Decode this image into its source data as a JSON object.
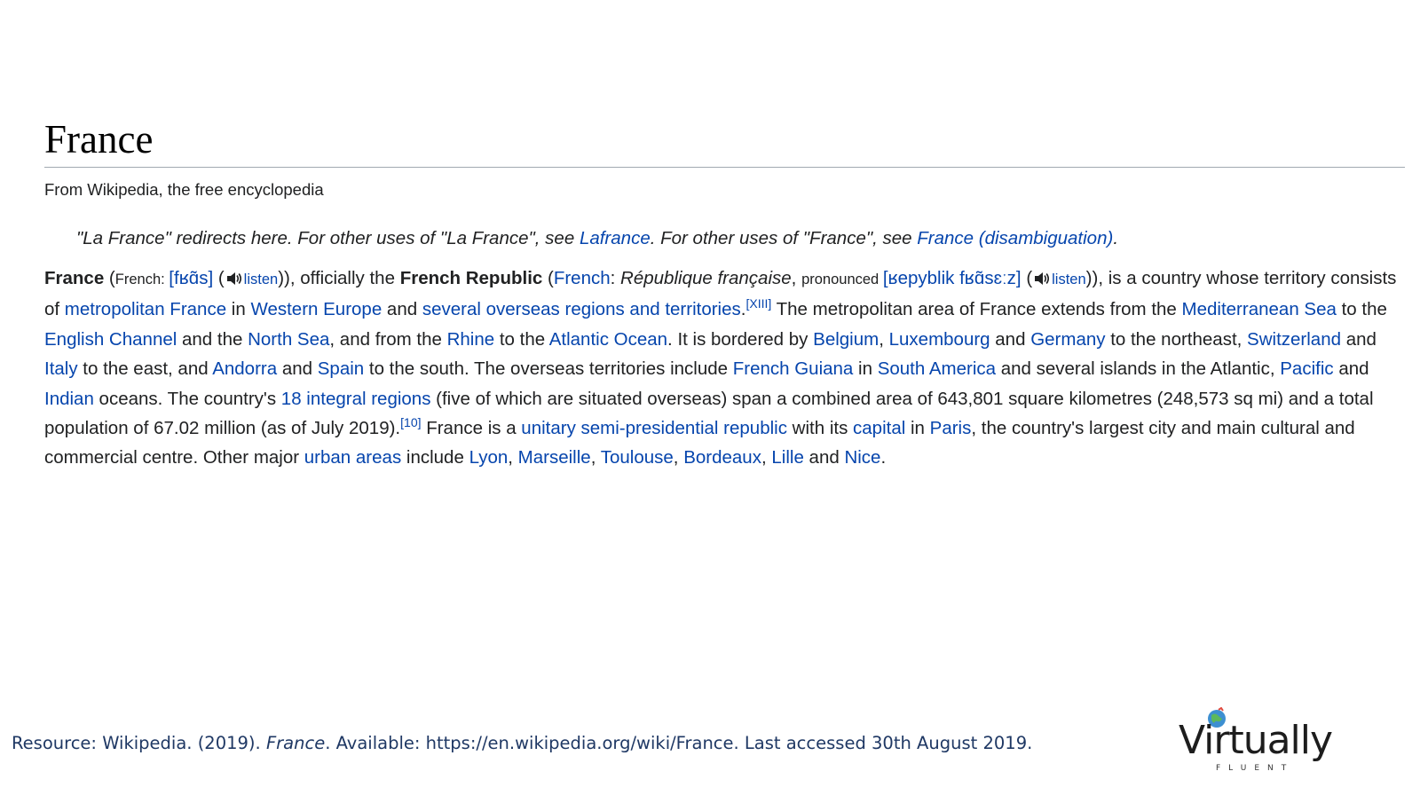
{
  "article": {
    "title": "France",
    "tagline": "From Wikipedia, the free encyclopedia",
    "hatnote": {
      "p1": "\"La France\" redirects here. For other uses of \"La France\", see ",
      "link1": "Lafrance",
      "p2": ". For other uses of \"France\", see ",
      "link2": "France (disambiguation)",
      "p3": "."
    },
    "lead": {
      "t1": "France",
      "t2": " (",
      "t3": "French: ",
      "l1": "[fʁɑ̃s]",
      "t4": " ",
      "l2": "listen",
      "t5": ")), officially the ",
      "t6": "French Republic",
      "t7": " (",
      "l3": "French",
      "t8": ": ",
      "t9": "République française",
      "t10": ", ",
      "t11": "pronounced ",
      "l4": "[ʁepyblik fʁɑ̃sɛːz]",
      "t12": " ",
      "l5": "listen",
      "t13": ")), is a country whose territory consists of ",
      "l6": "metropolitan France",
      "t14": " in ",
      "l7": "Western Europe",
      "t15": " and ",
      "l8": "several overseas regions and territories",
      "t16": ".",
      "s1": "[XIII]",
      "t17": " The metropolitan area of France extends from the ",
      "l9": "Mediterranean Sea",
      "t18": " to the ",
      "l10": "English Channel",
      "t19": " and the ",
      "l11": "North Sea",
      "t20": ", and from the ",
      "l12": "Rhine",
      "t21": " to the ",
      "l13": "Atlantic Ocean",
      "t22": ". It is bordered by ",
      "l14": "Belgium",
      "t23": ", ",
      "l15": "Luxembourg",
      "t24": " and ",
      "l16": "Germany",
      "t25": " to the northeast, ",
      "l17": "Switzerland",
      "t26": " and ",
      "l18": "Italy",
      "t27": " to the east, and ",
      "l19": "Andorra",
      "t28": " and ",
      "l20": "Spain",
      "t29": " to the south. The overseas territories include ",
      "l21": "French Guiana",
      "t30": " in ",
      "l22": "South America",
      "t31": " and several islands in the Atlantic, ",
      "l23": "Pacific",
      "t32": " and ",
      "l24": "Indian",
      "t33": " oceans. The country's ",
      "l25": "18 integral regions",
      "t34": " (five of which are situated overseas) span a combined area of 643,801 square kilometres (248,573 sq mi) and a total population of 67.02 million (as of July 2019).",
      "s2": "[10]",
      "t35": " France is a ",
      "l26": "unitary semi-presidential republic",
      "t36": " with its ",
      "l27": "capital",
      "t37": " in ",
      "l28": "Paris",
      "t38": ", the country's largest city and main cultural and commercial centre. Other major ",
      "l29": "urban areas",
      "t39": " include ",
      "l30": "Lyon",
      "t40": ", ",
      "l31": "Marseille",
      "t41": ", ",
      "l32": "Toulouse",
      "t42": ", ",
      "l33": "Bordeaux",
      "t43": ", ",
      "l34": "Lille",
      "t44": " and ",
      "l35": "Nice",
      "t45": "."
    }
  },
  "footer": {
    "r1": "Resource: Wikipedia. (2019). ",
    "r2": "France",
    "r3": ". Available: https://en.wikipedia.org/wiki/France.  Last accessed 30th August 2019."
  },
  "logo": {
    "word": "Virtually",
    "sub": "FLUENT"
  },
  "colors": {
    "link": "#0645ad",
    "text": "#202122",
    "footer": "#1f3864"
  },
  "icons": {
    "speaker": "speaker-icon",
    "globe": "globe-icon"
  }
}
